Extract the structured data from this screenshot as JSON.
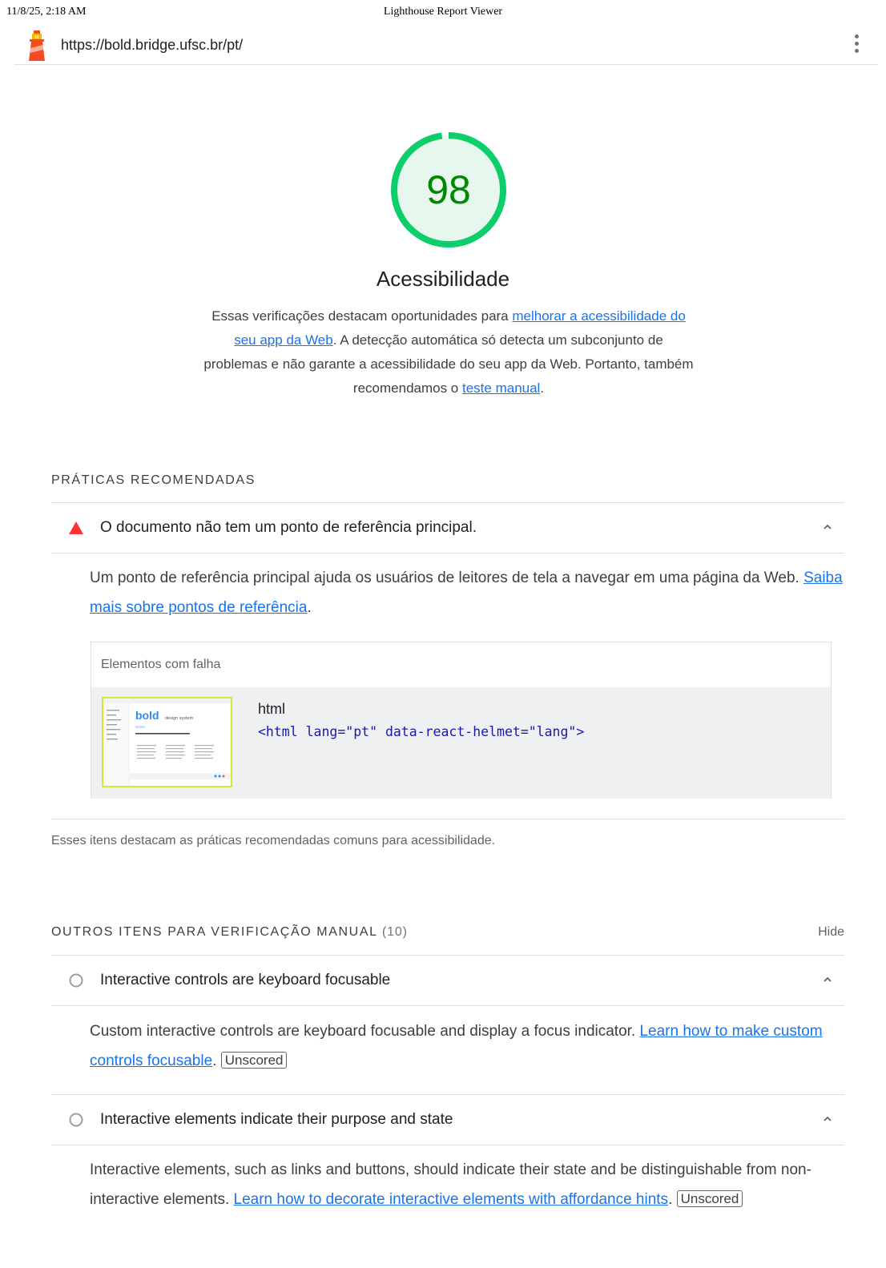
{
  "print_header": {
    "date": "11/8/25, 2:18 AM",
    "title": "Lighthouse Report Viewer"
  },
  "topbar": {
    "url": "https://bold.bridge.ufsc.br/pt/",
    "logo_icon": "lighthouse-icon",
    "menu_icon": "kebab-menu-icon"
  },
  "category": {
    "score": "98",
    "score_fraction": 0.98,
    "gauge_color": "#0cce6b",
    "title": "Acessibilidade",
    "desc_1": "Essas verificações destacam oportunidades para ",
    "desc_link_1": "melhorar a acessibilidade do seu app da Web",
    "desc_2": ". A detecção automática só detecta um subconjunto de problemas e não garante a acessibilidade do seu app da Web. Portanto, também recomendamos o ",
    "desc_link_2": "teste manual",
    "desc_3": "."
  },
  "best_practices": {
    "title": "PRÁTICAS RECOMENDADAS",
    "audit": {
      "status": "fail",
      "status_color": "#ff3333",
      "title": "O documento não tem um ponto de referência principal.",
      "desc": "Um ponto de referência principal ajuda os usuários de leitores de tela a navegar em uma página da Web. ",
      "desc_link": "Saiba mais sobre pontos de referência",
      "desc_end": ".",
      "table_header": "Elementos com falha",
      "node_label": "html",
      "node_snippet": "<html lang=\"pt\" data-react-helmet=\"lang\">",
      "thumb_brand": "bold",
      "thumb_subtitle": "design system"
    },
    "footer": "Esses itens destacam as práticas recomendadas comuns para acessibilidade."
  },
  "manual": {
    "title": "OUTROS ITENS PARA VERIFICAÇÃO MANUAL",
    "count": "(10)",
    "hide_label": "Hide",
    "audits": [
      {
        "title": "Interactive controls are keyboard focusable",
        "desc": "Custom interactive controls are keyboard focusable and display a focus indicator. ",
        "link": "Learn how to make custom controls focusable",
        "end": ".",
        "badge": "Unscored"
      },
      {
        "title": "Interactive elements indicate their purpose and state",
        "desc": "Interactive elements, such as links and buttons, should indicate their state and be distinguishable from non-interactive elements. ",
        "link": "Learn how to decorate interactive elements with affordance hints",
        "end": ".",
        "badge": "Unscored"
      }
    ]
  }
}
